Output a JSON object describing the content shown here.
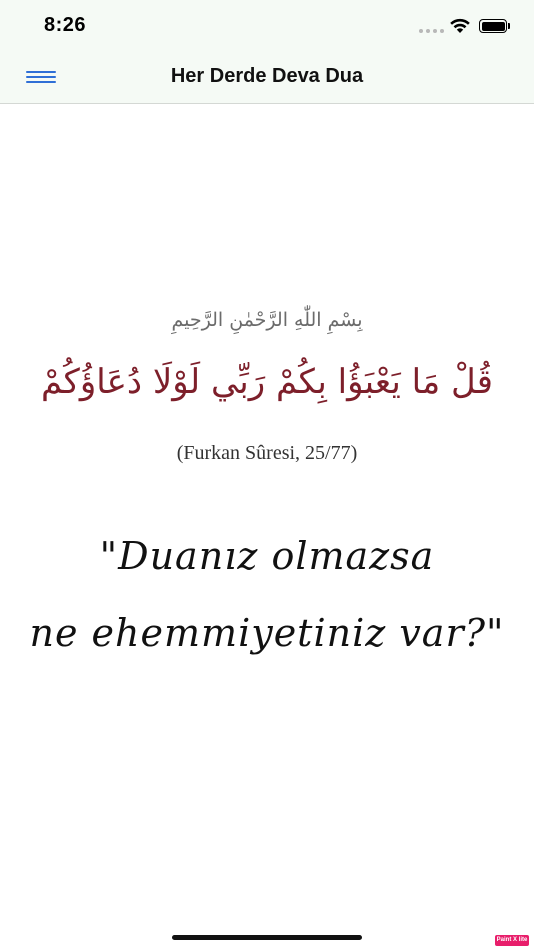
{
  "status_bar": {
    "time": "8:26"
  },
  "nav": {
    "title": "Her Derde Deva Dua",
    "menu_icon": "hamburger-icon"
  },
  "content": {
    "basmala": "بِسْمِ اللّٰهِ الرَّحْمٰنِ الرَّحِيمِ",
    "verse": "قُلْ مَا يَعْبَؤُا بِكُمْ رَبِّي لَوْلَا دُعَاؤُكُمْ",
    "reference": "(Furkan Sûresi, 25/77)",
    "quote_line_1": "\"Duanız olmazsa",
    "quote_line_2": "ne ehemmiyetiniz var?\""
  },
  "badge": {
    "label": "Paint X lite"
  },
  "colors": {
    "bar_background": "#f5faf5",
    "menu_accent": "#2f6fd6",
    "verse_color": "#7d1f2a",
    "badge_color": "#e81e6b"
  }
}
